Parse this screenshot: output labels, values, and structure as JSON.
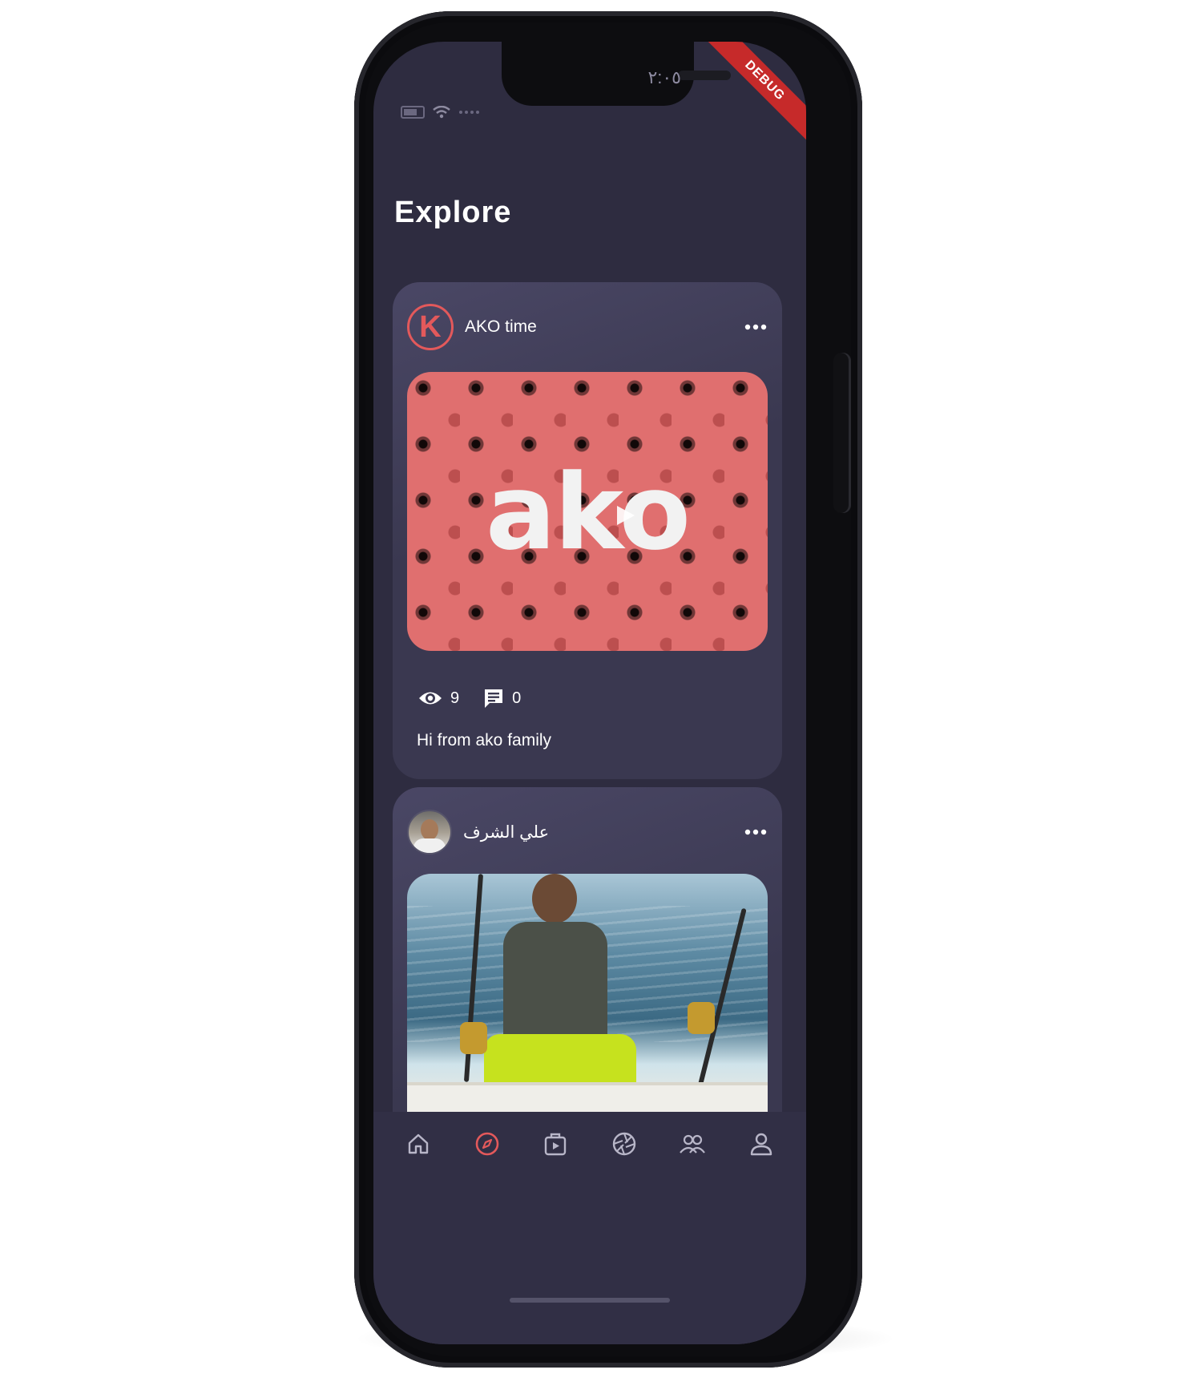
{
  "status_bar": {
    "time": "٢:٠٥",
    "debug_label": "DEBUG"
  },
  "page": {
    "title": "Explore"
  },
  "posts": [
    {
      "author": "AKO time",
      "avatar_letter": "K",
      "media_logo": "ako",
      "views": "9",
      "comments": "0",
      "caption": "Hi from ako family"
    },
    {
      "author": "علي الشرف"
    }
  ],
  "icons": {
    "more": "more-horizontal-icon",
    "views": "eye-icon",
    "comments": "comment-icon",
    "play": "play-icon"
  },
  "nav": {
    "items": [
      {
        "icon": "home-icon",
        "active": false
      },
      {
        "icon": "compass-icon",
        "active": true
      },
      {
        "icon": "video-bag-icon",
        "active": false
      },
      {
        "icon": "camera-shutter-icon",
        "active": false
      },
      {
        "icon": "group-icon",
        "active": false
      },
      {
        "icon": "profile-icon",
        "active": false
      }
    ]
  },
  "colors": {
    "background": "#2e2c40",
    "card": "#3a3850",
    "accent": "#e3595b",
    "media": "#e06f6f",
    "text": "#ffffff",
    "nav_inactive": "#b8b6c8"
  }
}
